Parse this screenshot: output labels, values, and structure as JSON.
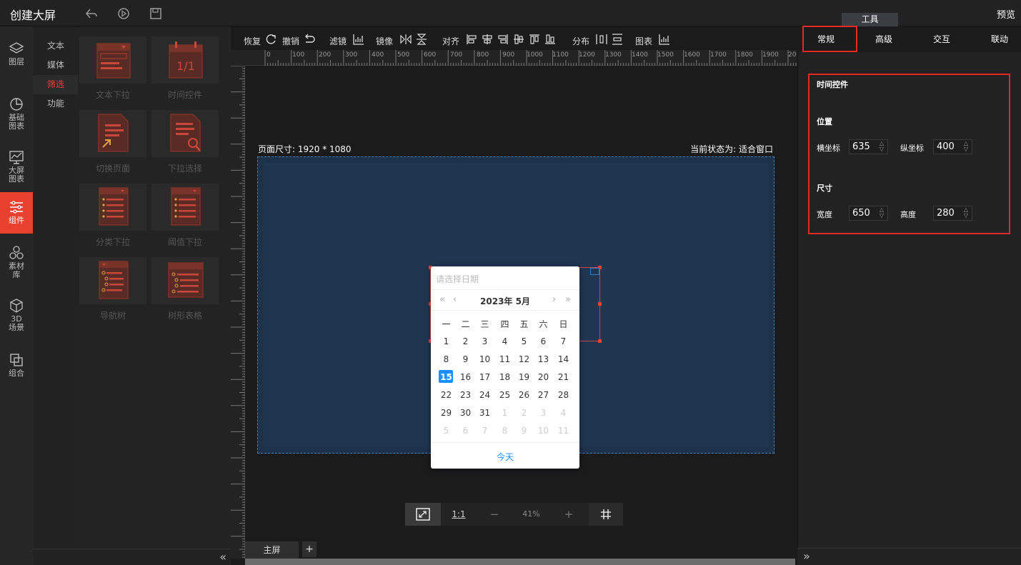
{
  "header": {
    "title": "创建大屏",
    "preview_label": "预览",
    "tools_tab": "工具"
  },
  "leftnav": {
    "items": [
      {
        "label": "图层",
        "icon": "layers-icon"
      },
      {
        "label": "基础图表",
        "icon": "pie-chart-icon"
      },
      {
        "label": "大屏图表",
        "icon": "screen-chart-icon"
      },
      {
        "label": "组件",
        "icon": "sliders-icon"
      },
      {
        "label": "素材库",
        "icon": "assets-icon"
      },
      {
        "label": "3D场景",
        "icon": "cube-icon"
      },
      {
        "label": "组合",
        "icon": "group-icon"
      }
    ]
  },
  "subnav": {
    "items": [
      "文本",
      "媒体",
      "筛选",
      "功能"
    ]
  },
  "components": {
    "cards": [
      "文本下拉",
      "时间控件",
      "切换页面",
      "下拉选择",
      "分类下拉",
      "阈值下拉",
      "导航树",
      "树形表格"
    ],
    "time_thumb_text": "1/1"
  },
  "toolbar": {
    "restore": "恢复",
    "undo": "撤销",
    "filter": "滤镜",
    "mirror": "镜像",
    "align": "对齐",
    "distribute": "分布",
    "chart": "图表"
  },
  "ruler": {
    "marks": [
      "0",
      "100",
      "200",
      "300",
      "400",
      "500",
      "600",
      "700",
      "800",
      "900",
      "1000",
      "1100",
      "1200",
      "1300",
      "1400",
      "1500",
      "1600",
      "1700",
      "1800",
      "1900",
      "20"
    ]
  },
  "canvas": {
    "page_size": "页面尺寸: 1920 * 1080",
    "state": "当前状态为: 适合窗口"
  },
  "datepicker": {
    "placeholder": "请选择日期",
    "title": "2023年 5月",
    "prev_year": "«",
    "prev_month": "‹",
    "next_month": "›",
    "next_year": "»",
    "weekdays": [
      "一",
      "二",
      "三",
      "四",
      "五",
      "六",
      "日"
    ],
    "weeks": [
      [
        "1",
        "2",
        "3",
        "4",
        "5",
        "6",
        "7"
      ],
      [
        "8",
        "9",
        "10",
        "11",
        "12",
        "13",
        "14"
      ],
      [
        "15",
        "16",
        "17",
        "18",
        "19",
        "20",
        "21"
      ],
      [
        "22",
        "23",
        "24",
        "25",
        "26",
        "27",
        "28"
      ],
      [
        "29",
        "30",
        "31",
        "1",
        "2",
        "3",
        "4"
      ],
      [
        "5",
        "6",
        "7",
        "8",
        "9",
        "10",
        "11"
      ]
    ],
    "selected": "15",
    "today": "今天"
  },
  "zoombar": {
    "actual_size": "1:1",
    "minus": "−",
    "zoom": "41%",
    "plus": "+"
  },
  "tabs": {
    "main": "主屏",
    "add": "+"
  },
  "rightpanel": {
    "tabs": [
      "常规",
      "高级",
      "交互",
      "联动"
    ],
    "section_title": "时间控件",
    "position_title": "位置",
    "x_label": "横坐标",
    "x_value": "635",
    "y_label": "纵坐标",
    "y_value": "400",
    "size_title": "尺寸",
    "w_label": "宽度",
    "w_value": "650",
    "h_label": "高度",
    "h_value": "280"
  },
  "colors": {
    "accent": "#e8412f",
    "highlight_box": "#e32a26",
    "screen_bg": "#1d3149",
    "picker_selected": "#1890ff"
  }
}
